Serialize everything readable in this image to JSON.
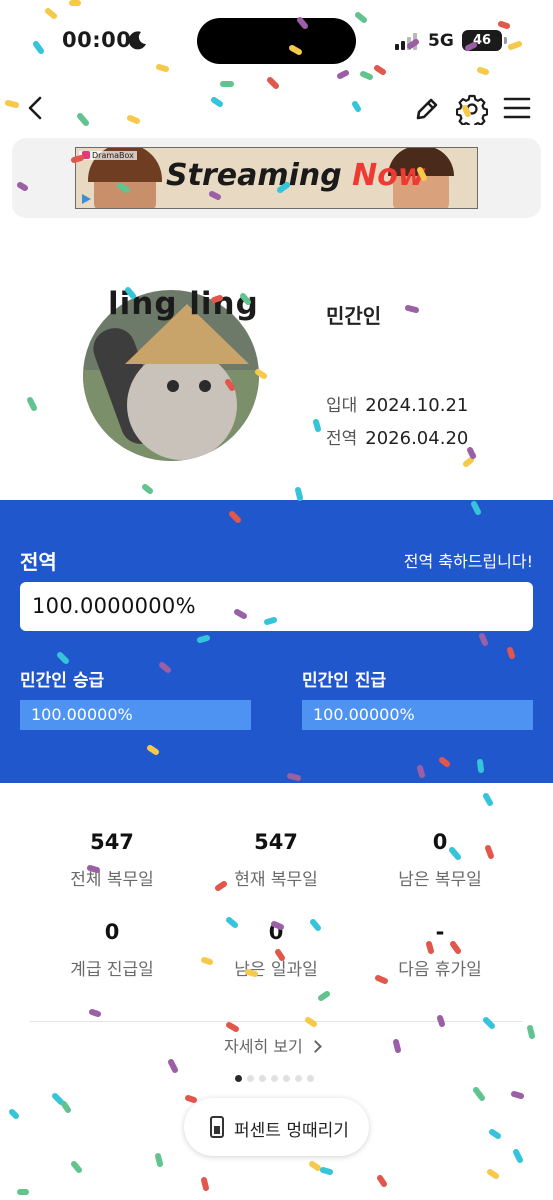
{
  "status_bar": {
    "time": "00:00",
    "network": "5G",
    "battery": "46"
  },
  "nav": {
    "back_icon": "chevron-left-icon",
    "edit_icon": "pencil-icon",
    "settings_icon": "gear-icon",
    "menu_icon": "hamburger-icon"
  },
  "ad": {
    "brand": "DramaBox",
    "headline_1": "Streaming",
    "headline_2": "Now"
  },
  "profile": {
    "nickname": "ling ling",
    "rank": "민간인",
    "enlist_label": "입대",
    "enlist_date": "2024.10.21",
    "discharge_label": "전역",
    "discharge_date": "2026.04.20"
  },
  "progress": {
    "title": "전역",
    "congrats": "전역 축하드립니다!",
    "total_percent": "100.0000000%",
    "promotion_label": "민간인 승급",
    "promotion_percent": "100.00000%",
    "advance_label": "민간인 진급",
    "advance_percent": "100.00000%",
    "colors": {
      "panel": "#2157cc",
      "bar": "#4e92f2"
    }
  },
  "stats": [
    {
      "value": "547",
      "label": "전체 복무일"
    },
    {
      "value": "547",
      "label": "현재 복무일"
    },
    {
      "value": "0",
      "label": "남은 복무일"
    },
    {
      "value": "0",
      "label": "계급 진급일"
    },
    {
      "value": "0",
      "label": "남은 일과일"
    },
    {
      "value": "-",
      "label": "다음 휴가일"
    }
  ],
  "detail_link": "자세히 보기",
  "pager": {
    "current": 1,
    "total": 7
  },
  "pill_button": "퍼센트 멍때리기"
}
